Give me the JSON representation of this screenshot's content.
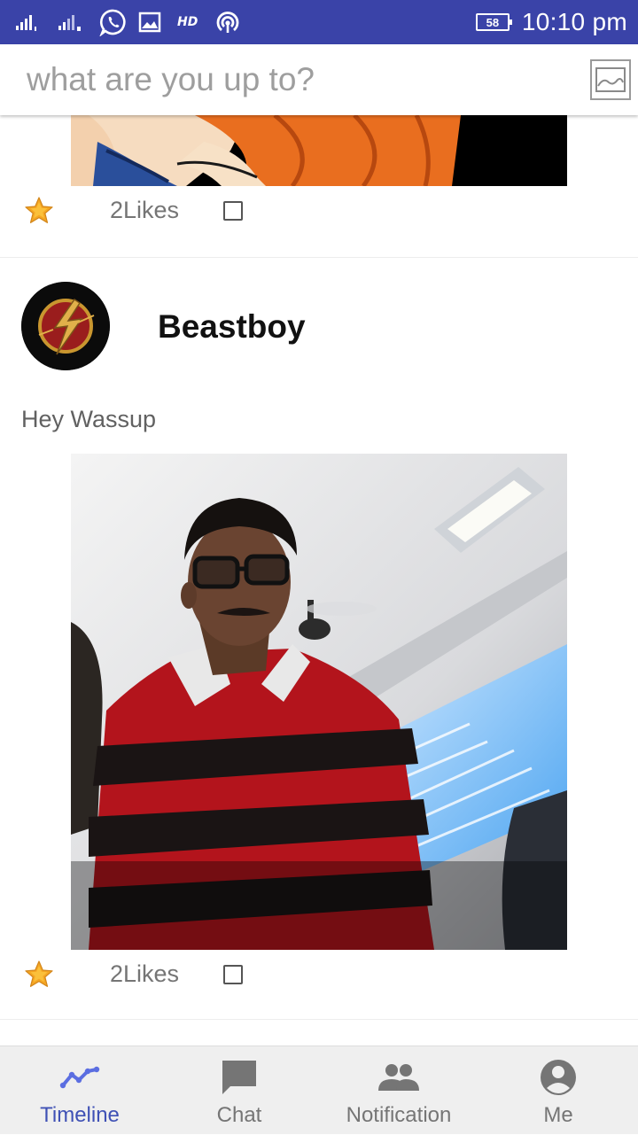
{
  "status_bar": {
    "icons": [
      "signal-sim1-icon",
      "signal-sim2-icon",
      "whatsapp-icon",
      "gallery-icon",
      "hd-icon",
      "hotspot-icon"
    ],
    "hd_label": "HD",
    "battery_level": "58",
    "time": "10:10 pm",
    "background_color": "#3a43a8"
  },
  "compose": {
    "placeholder": "what are you up to?",
    "attach_icon": "image-icon"
  },
  "feed": {
    "posts": [
      {
        "image": "anime-character-image",
        "likes_label": "2Likes",
        "like_icon": "star-icon",
        "liked": false
      },
      {
        "username": "Beastboy",
        "avatar": "flash-logo-avatar",
        "text": "Hey Wassup",
        "image": "selfie-photo",
        "likes_label": "2Likes",
        "like_icon": "star-icon",
        "liked": false
      }
    ]
  },
  "bottom_nav": {
    "items": [
      {
        "label": "Timeline",
        "icon": "timeline-icon",
        "active": true
      },
      {
        "label": "Chat",
        "icon": "chat-icon",
        "active": false
      },
      {
        "label": "Notification",
        "icon": "people-icon",
        "active": false
      },
      {
        "label": "Me",
        "icon": "account-icon",
        "active": false
      }
    ],
    "active_color": "#3f51b5",
    "inactive_color": "#757575"
  }
}
